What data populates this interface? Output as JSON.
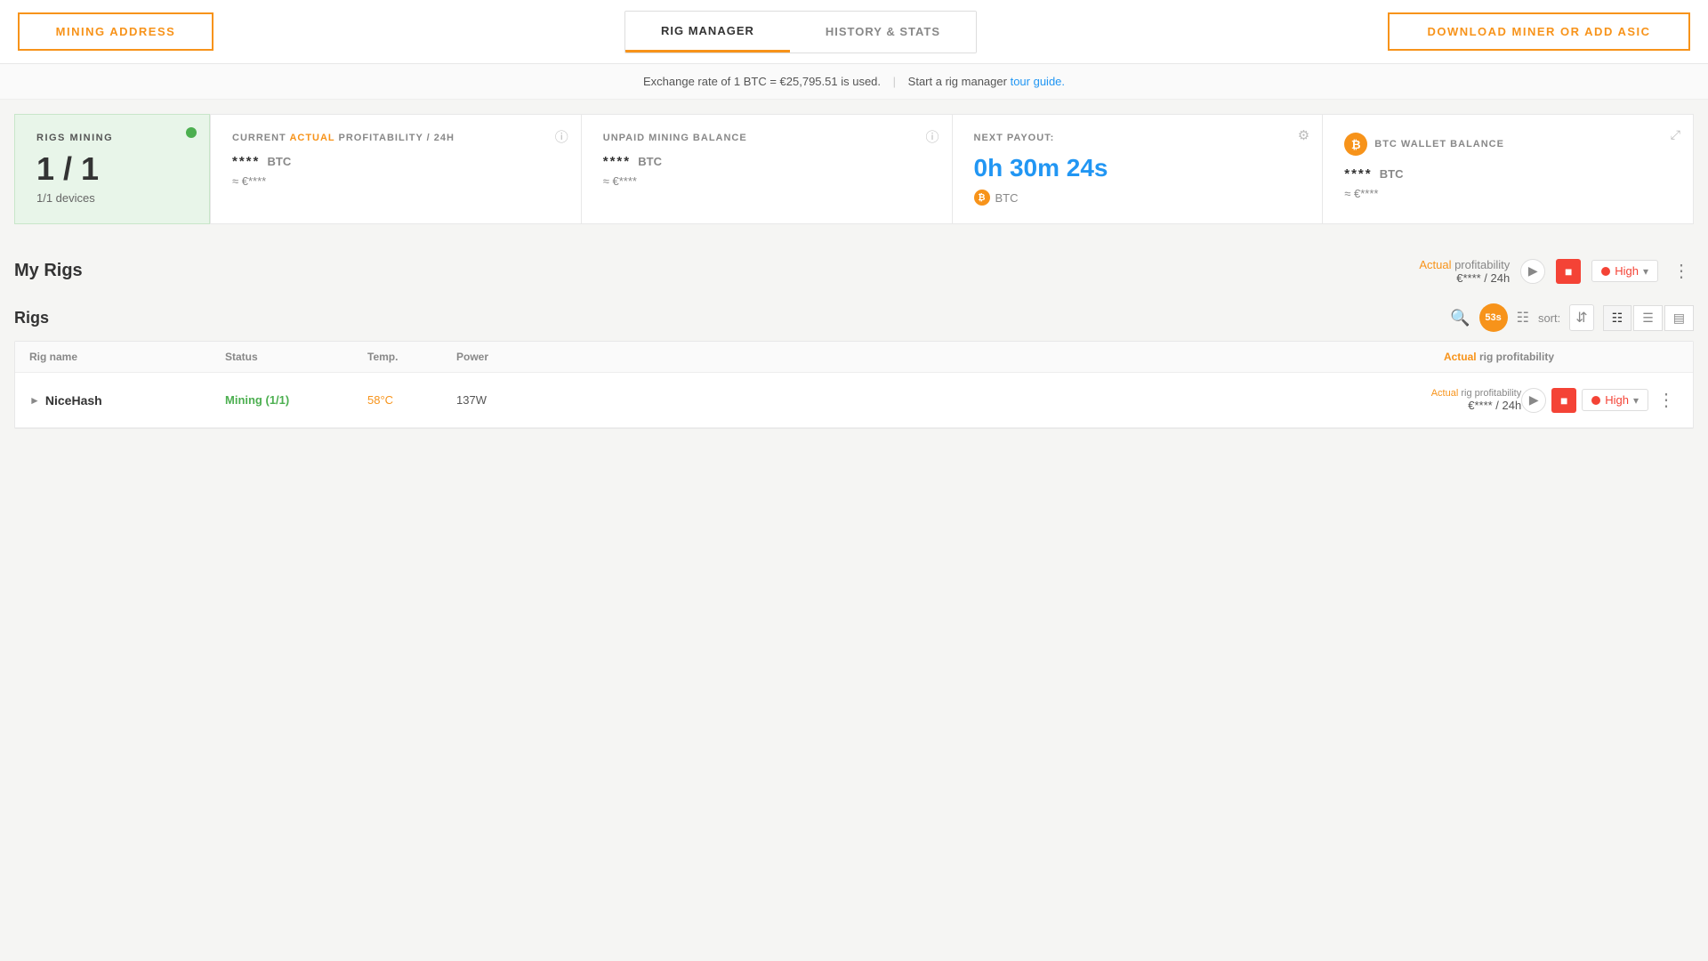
{
  "nav": {
    "mining_address_label": "MINING ADDRESS",
    "tab_rig_manager": "RIG MANAGER",
    "tab_history_stats": "HISTORY & STATS",
    "download_label": "DOWNLOAD MINER OR ADD ASIC"
  },
  "exchange_bar": {
    "text": "Exchange rate of 1 BTC = €25,795.51 is used.",
    "divider": "|",
    "rig_manager_text": "Start a rig manager",
    "tour_guide_link": "tour guide."
  },
  "cards": {
    "rigs_mining": {
      "label": "RIGS MINING",
      "value": "1 / 1",
      "devices": "1/1 devices"
    },
    "current_profitability": {
      "label_pre": "CURRENT ",
      "label_actual": "ACTUAL",
      "label_post": " PROFITABILITY / 24H",
      "value": "****",
      "currency": "BTC",
      "sub_value": "≈ €****"
    },
    "unpaid_mining": {
      "label": "UNPAID MINING BALANCE",
      "value": "****",
      "currency": "BTC",
      "sub_value": "≈ €****"
    },
    "next_payout": {
      "label": "NEXT PAYOUT:",
      "time": "0h 30m 24s",
      "currency": "BTC"
    },
    "btc_wallet": {
      "label": "BTC WALLET BALANCE",
      "icon_text": "₿",
      "value": "****",
      "currency": "BTC",
      "sub_value": "≈ €****"
    }
  },
  "my_rigs": {
    "title": "My Rigs",
    "profitability_label_pre": "Actual",
    "profitability_label_post": " profitability",
    "profitability_value": "€**** / 24h",
    "high_label": "High",
    "dropdown_arrow": "▾"
  },
  "rigs": {
    "title": "Rigs",
    "timer": "53s",
    "sort_label": "sort:",
    "table": {
      "headers": {
        "rig_name": "Rig name",
        "status": "Status",
        "temp": "Temp.",
        "power": "Power"
      },
      "profit_header": "Actual rig profitability",
      "rows": [
        {
          "name": "NiceHash",
          "status": "Mining (1/1)",
          "temp": "58°C",
          "power": "137W",
          "profit_label_pre": "Actual",
          "profit_label_post": " rig profitability",
          "profit_value": "€**** / 24h",
          "high_label": "High"
        }
      ]
    }
  }
}
